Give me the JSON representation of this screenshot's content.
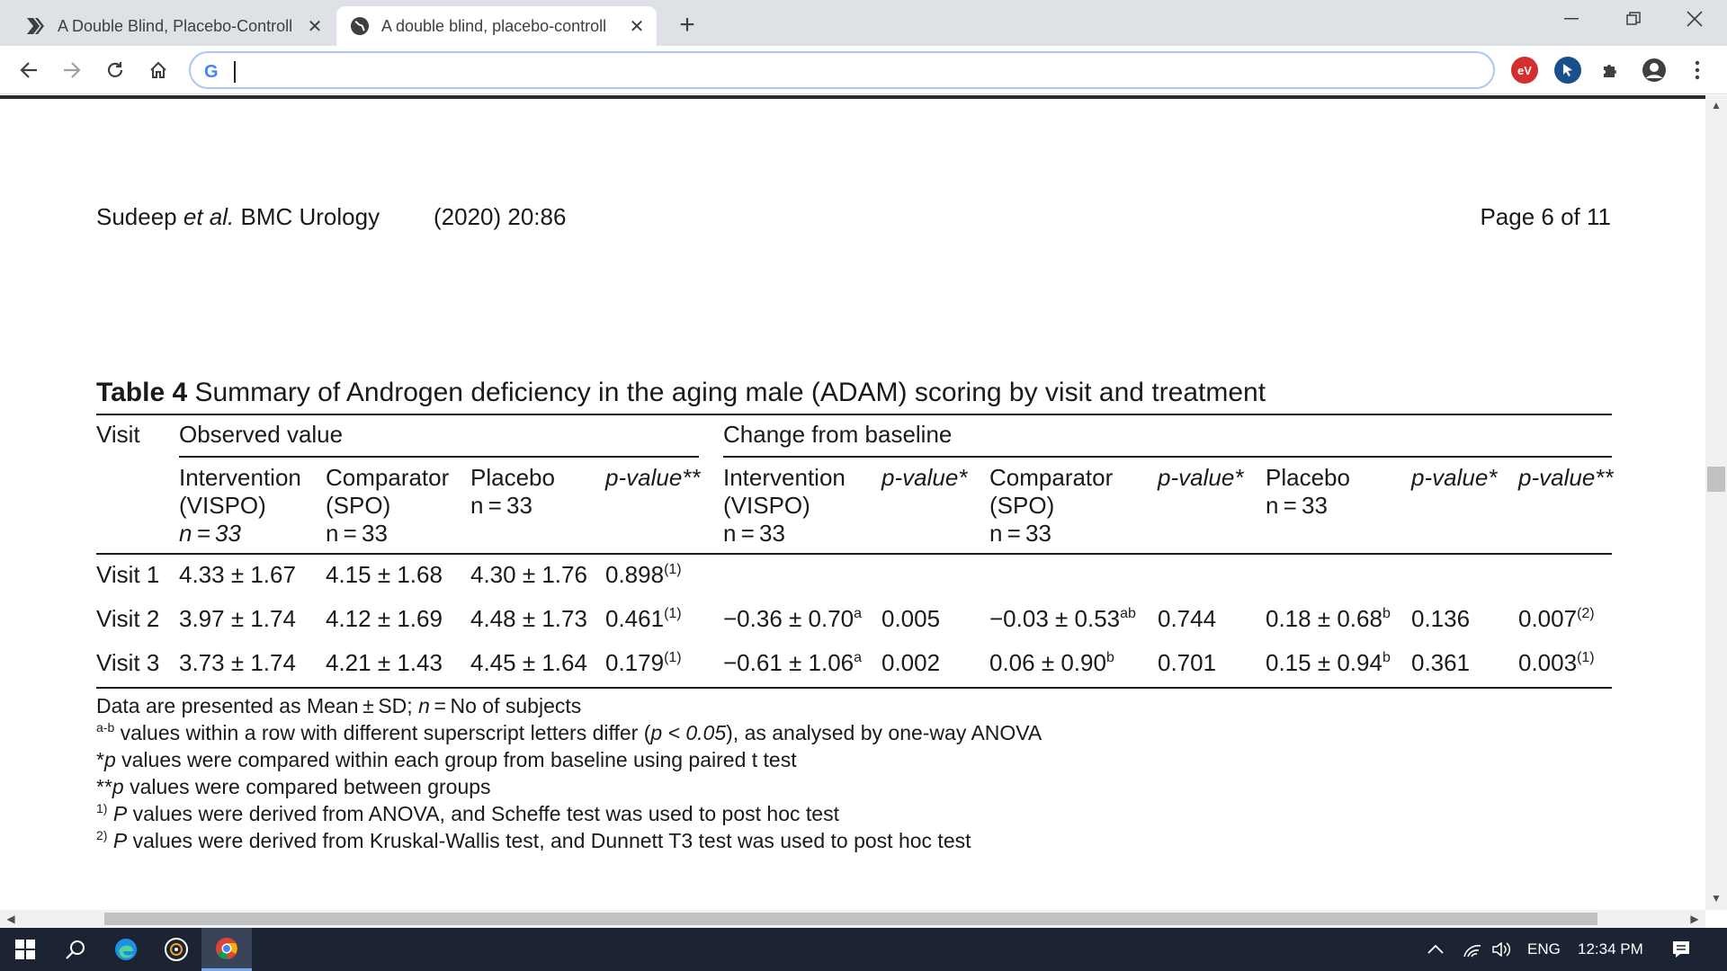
{
  "browser": {
    "tabs": [
      {
        "title": "A Double Blind, Placebo-Controll",
        "active": false
      },
      {
        "title": "A double blind, placebo-controll",
        "active": true
      }
    ],
    "omnibox_value": ""
  },
  "document": {
    "header_authors": "Sudeep ",
    "header_etal": "et al.",
    "header_journal": " BMC Urology",
    "header_year": "(2020) 20:86",
    "header_page": "Page 6 of 11",
    "table_label": "Table 4",
    "table_caption": " Summary of Androgen deficiency in the aging male (ADAM) scoring by visit and treatment",
    "col_visit": "Visit",
    "group_observed": "Observed value",
    "group_change": "Change from baseline",
    "obs_headers": [
      {
        "l1": "Intervention",
        "l2": "(VISPO)",
        "l3": "n = 33"
      },
      {
        "l1": "Comparator",
        "l2": "(SPO)",
        "l3": "n = 33"
      },
      {
        "l1": "Placebo",
        "l2": "n = 33",
        "l3": ""
      },
      {
        "l1": "p-value**",
        "l2": "",
        "l3": ""
      }
    ],
    "chg_headers": [
      {
        "l1": "Intervention",
        "l2": "(VISPO)",
        "l3": "n = 33"
      },
      {
        "l1": "p-value*",
        "l2": "",
        "l3": ""
      },
      {
        "l1": "Comparator",
        "l2": "(SPO)",
        "l3": "n = 33"
      },
      {
        "l1": "p-value*",
        "l2": "",
        "l3": ""
      },
      {
        "l1": "Placebo",
        "l2": "n = 33",
        "l3": ""
      },
      {
        "l1": "p-value*",
        "l2": "",
        "l3": ""
      },
      {
        "l1": "p-value**",
        "l2": "",
        "l3": ""
      }
    ],
    "rows": [
      {
        "visit": "Visit 1",
        "obs_int": "4.33 ± 1.67",
        "obs_cmp": "4.15 ± 1.68",
        "obs_plc": "4.30 ± 1.76",
        "obs_p": "0.898",
        "obs_p_sup": "(1)",
        "chg_int": "",
        "chg_int_sup": "",
        "chg_int_p": "",
        "chg_cmp": "",
        "chg_cmp_sup": "",
        "chg_cmp_p": "",
        "chg_plc": "",
        "chg_plc_sup": "",
        "chg_plc_p": "",
        "chg_p": "",
        "chg_p_sup": ""
      },
      {
        "visit": "Visit 2",
        "obs_int": "3.97 ± 1.74",
        "obs_cmp": "4.12 ± 1.69",
        "obs_plc": "4.48 ± 1.73",
        "obs_p": "0.461",
        "obs_p_sup": "(1)",
        "chg_int": "−0.36 ± 0.70",
        "chg_int_sup": "a",
        "chg_int_p": "0.005",
        "chg_cmp": "−0.03 ± 0.53",
        "chg_cmp_sup": "ab",
        "chg_cmp_p": "0.744",
        "chg_plc": "0.18 ± 0.68",
        "chg_plc_sup": "b",
        "chg_plc_p": "0.136",
        "chg_p": "0.007",
        "chg_p_sup": "(2)"
      },
      {
        "visit": "Visit 3",
        "obs_int": "3.73 ± 1.74",
        "obs_cmp": "4.21 ± 1.43",
        "obs_plc": "4.45 ± 1.64",
        "obs_p": "0.179",
        "obs_p_sup": "(1)",
        "chg_int": "−0.61 ± 1.06",
        "chg_int_sup": "a",
        "chg_int_p": "0.002",
        "chg_cmp": "0.06 ± 0.90",
        "chg_cmp_sup": "b",
        "chg_cmp_p": "0.701",
        "chg_plc": "0.15 ± 0.94",
        "chg_plc_sup": "b",
        "chg_plc_p": "0.361",
        "chg_p": "0.003",
        "chg_p_sup": "(1)"
      }
    ],
    "notes": {
      "n1_a": "Data are presented as Mean ± SD; ",
      "n1_n": "n",
      "n1_b": " = No of subjects",
      "n2_sup": "a-b",
      "n2_a": " values within a row with different superscript letters differ (",
      "n2_p": "p",
      "n2_b": " < 0.05",
      "n2_c": "), as analysed by one-way ANOVA",
      "n3_a": "*",
      "n3_p": "p",
      "n3_b": " values were compared within each group from baseline using paired t test",
      "n4_a": "**",
      "n4_p": "p",
      "n4_b": " values were compared between groups",
      "n5_sup": "1)",
      "n5_p": " P",
      "n5_b": " values were derived from ANOVA, and Scheffe test was used to post hoc test",
      "n6_sup": "2)",
      "n6_p": " P",
      "n6_b": " values were derived from Kruskal-Wallis test, and Dunnett T3 test was used to post hoc test"
    }
  },
  "taskbar": {
    "language": "ENG",
    "time": "12:34 PM"
  },
  "icons": {
    "back": "arrow-left-icon",
    "forward": "arrow-right-icon",
    "reload": "reload-icon",
    "home": "home-icon",
    "extensions": "puzzle-icon",
    "profile": "profile-icon",
    "menu": "kebab-menu-icon"
  },
  "colors": {
    "tabstrip_bg": "#dee1e6",
    "omnibox_focus": "#a8c7fa",
    "taskbar_bg": "#1c2333",
    "ext_red": "#d32f2f",
    "ext_blue": "#1a4f8b"
  }
}
